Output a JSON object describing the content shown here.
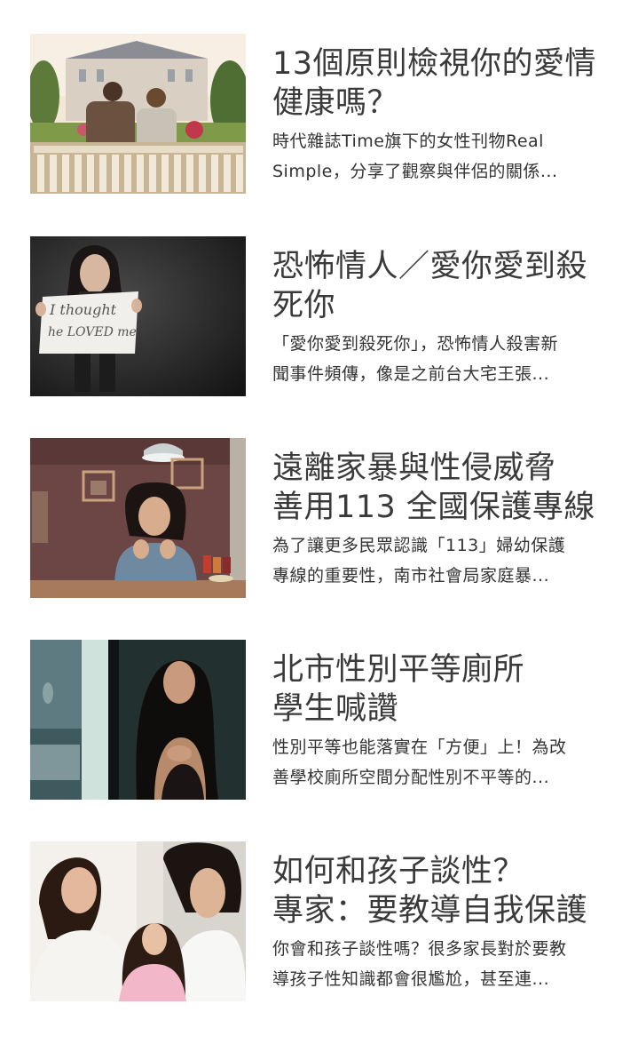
{
  "articles": [
    {
      "title_line1": "13個原則檢視你的愛情",
      "title_line2": "健康嗎？",
      "desc_line1": "時代雜誌Time旗下的女性刊物Real",
      "desc_line2": "Simple，分享了觀察與伴侶的關係...",
      "thumb_icon": "couple-on-bench-photo"
    },
    {
      "title_line1": "恐怖情人／愛你愛到殺",
      "title_line2": "死你",
      "desc_line1": "「愛你愛到殺死你」，恐怖情人殺害新",
      "desc_line2": "聞事件頻傳，像是之前台大宅王張...",
      "thumb_icon": "woman-holding-sign-photo",
      "sign_line1": "I thought",
      "sign_line2": "he LOVED me"
    },
    {
      "title_line1": "遠離家暴與性侵威脅",
      "title_line2": "善用113 全國保護專線",
      "desc_line1": "為了讓更多民眾認識「113」婦幼保護",
      "desc_line2": "專線的重要性，南市社會局家庭暴...",
      "thumb_icon": "woman-at-table-photo"
    },
    {
      "title_line1": "北市性別平等廁所",
      "title_line2": "學生喊讚",
      "desc_line1": "性別平等也能落實在「方便」上！為改",
      "desc_line2": "善學校廁所空間分配性別不平等的...",
      "thumb_icon": "woman-in-doorway-photo"
    },
    {
      "title_line1": "如何和孩子談性？",
      "title_line2": "專家：要教導自我保護",
      "desc_line1": "你會和孩子談性嗎？很多家長對於要教",
      "desc_line2": "導孩子性知識都會很尷尬，甚至連...",
      "thumb_icon": "family-with-child-photo"
    }
  ]
}
